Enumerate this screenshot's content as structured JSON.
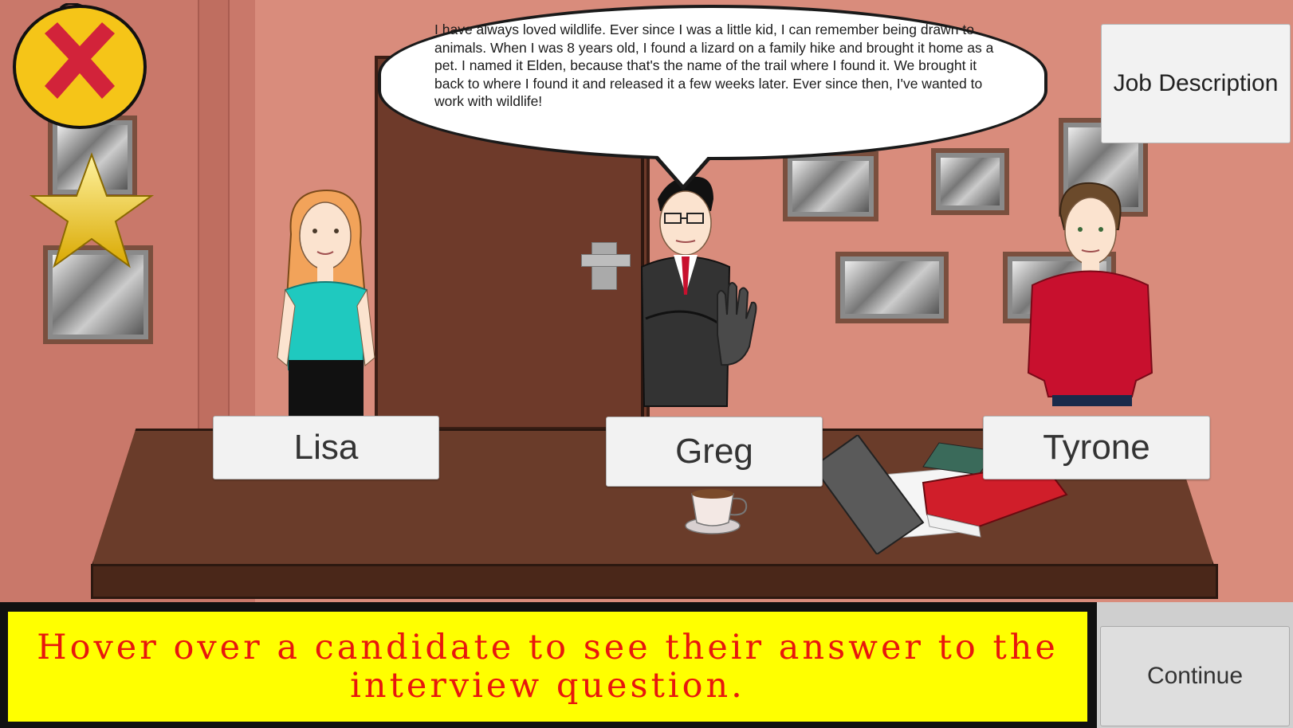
{
  "speech": {
    "text": "I have always loved wildlife. Ever since I was a little kid, I can remember being drawn to animals. When I was 8 years old, I found a lizard on a family hike and brought it home as a pet. I named it Elden, because that's the name of the trail where I found it. We brought it back to where I found it and released it a few weeks later. Ever since then, I've wanted to work with wildlife!"
  },
  "candidates": [
    {
      "name": "Lisa"
    },
    {
      "name": "Greg"
    },
    {
      "name": "Tyrone"
    }
  ],
  "buttons": {
    "job_description": "Job Description",
    "continue": "Continue"
  },
  "instruction": {
    "text": "Hover over a candidate to see their answer to the interview question."
  },
  "icons": {
    "close": "close-icon",
    "star": "star-icon",
    "stop_hand": "stop-hand-icon"
  },
  "colors": {
    "instruction_bg": "#ffff00",
    "instruction_text": "#e8170d",
    "close_bg": "#f5c518",
    "close_x": "#d2233a",
    "star": "#f0c419"
  }
}
